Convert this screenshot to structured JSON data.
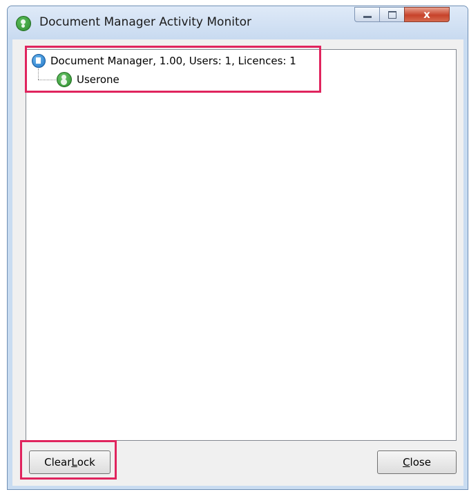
{
  "window": {
    "title": "Document Manager Activity Monitor",
    "controls": {
      "close_glyph": "x"
    }
  },
  "tree": {
    "root": {
      "icon": "document-icon",
      "label": "Document Manager, 1.00, Users: 1, Licences: 1",
      "children": [
        {
          "icon": "user-icon",
          "label": "Userone"
        }
      ]
    }
  },
  "buttons": {
    "clear_lock": {
      "pre": "Clear ",
      "mnemonic": "L",
      "post": "ock"
    },
    "close": {
      "pre": "",
      "mnemonic": "C",
      "post": "lose"
    }
  },
  "colors": {
    "highlight": "#e0245e",
    "window_frame": "#c9dcf1",
    "close_button": "#c7432b"
  }
}
